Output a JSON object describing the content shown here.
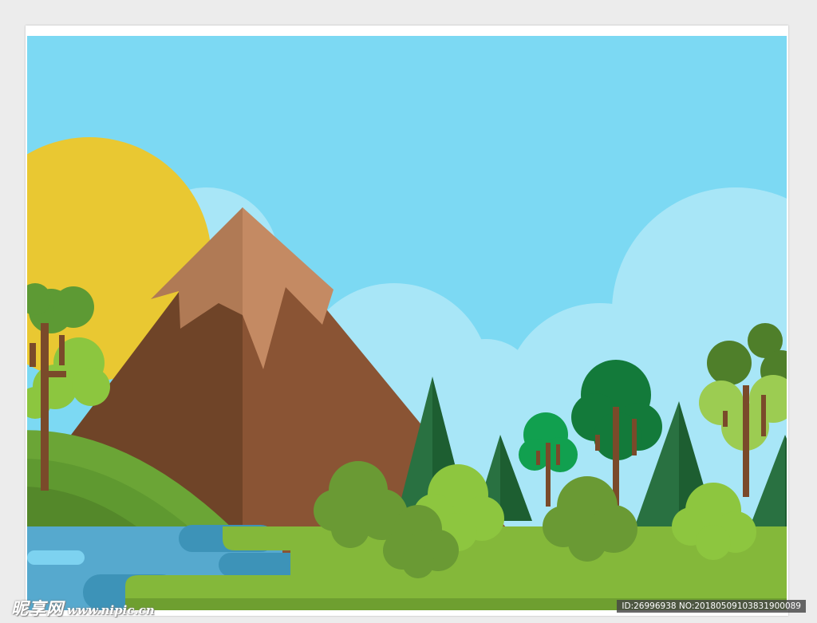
{
  "watermark": {
    "brand": "昵享网",
    "url": "www.nipic.cn",
    "id_text": "ID:26996938 NO:20180509103831900089"
  },
  "colors": {
    "sky": "#7cd9f3",
    "cloud": "#a8e6f7",
    "sun": "#e9c832",
    "mountain_left": "#6f4428",
    "mountain_right": "#8a5434",
    "snow_left": "#b07a55",
    "snow_right": "#c48a63",
    "hill_light": "#6ba536",
    "hill_mid": "#5f9930",
    "hill_dark": "#54882a",
    "grass": "#84b83a",
    "grass_shade": "#6e9f30",
    "water": "#56a9ce",
    "water_dark": "#3d93b8",
    "water_light": "#7dd2f0",
    "pine_dark": "#1d5e31",
    "pine_light": "#297141",
    "trunk": "#7a4a2a"
  },
  "scene": {
    "elements": [
      "sun",
      "clouds",
      "mountain",
      "hills",
      "river",
      "grass",
      "pine-trees",
      "round-trees",
      "bushes"
    ]
  }
}
